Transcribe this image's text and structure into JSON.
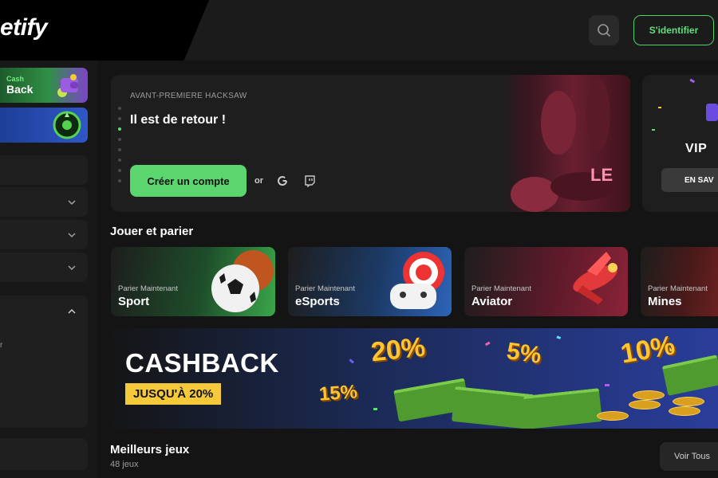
{
  "header": {
    "logo_text": "etify",
    "login_label": "S'identifier",
    "search_icon": "search-icon"
  },
  "sidebar": {
    "cashback_promo": {
      "small": "Cash",
      "big": "Back"
    },
    "partial_label": "r"
  },
  "hero": {
    "eyebrow": "AVANT-PREMIERE HACKSAW",
    "title": "Il est de retour !",
    "cta_label": "Créer un compte",
    "or_label": "or",
    "art_text": "LE"
  },
  "vip_card": {
    "title": "VIP",
    "button_label": "EN SAV"
  },
  "play_section": {
    "title": "Jouer et parier",
    "cards": [
      {
        "sub": "Parier Maintenant",
        "name": "Sport"
      },
      {
        "sub": "Parier Maintenant",
        "name": "eSports"
      },
      {
        "sub": "Parier Maintenant",
        "name": "Aviator"
      },
      {
        "sub": "Parier Maintenant",
        "name": "Mines"
      }
    ]
  },
  "cashback_banner": {
    "title": "CASHBACK",
    "tag": "JUSQU'À 20%",
    "percents": [
      "20%",
      "5%",
      "10%",
      "15%"
    ]
  },
  "best_games": {
    "title": "Meilleurs jeux",
    "count": "48 jeux",
    "see_all": "Voir Tous"
  },
  "colors": {
    "accent_green": "#5bd66f",
    "background": "#141414",
    "card": "#1e1e1e",
    "gold": "#f5c93a"
  }
}
